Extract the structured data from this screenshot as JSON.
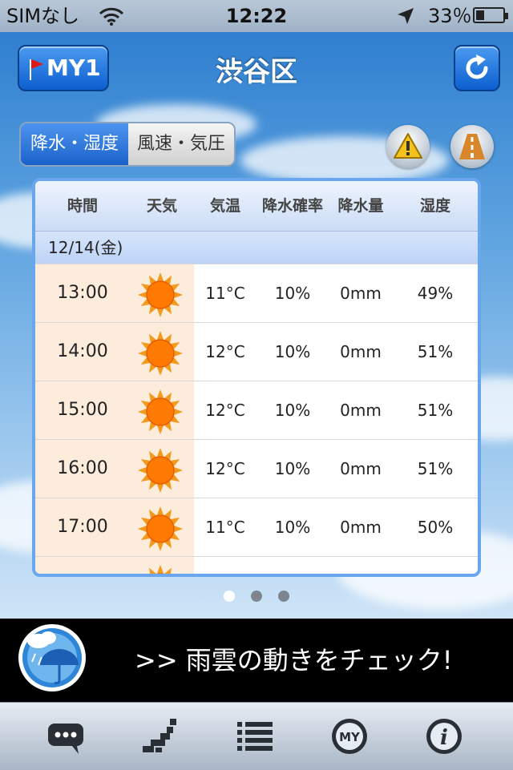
{
  "status": {
    "carrier": "SIMなし",
    "time": "12:22",
    "battery": "33％"
  },
  "header": {
    "my_button": "MY1",
    "title": "渋谷区"
  },
  "segment": {
    "active": "降水・湿度",
    "inactive": "風速・気圧"
  },
  "icons": {
    "warning": "warning-icon",
    "road": "road-icon",
    "refresh": "refresh-icon"
  },
  "table": {
    "headers": [
      "時間",
      "天気",
      "気温",
      "降水確率",
      "降水量",
      "湿度"
    ],
    "date": "12/14(金)",
    "rows": [
      {
        "time": "13:00",
        "weather": "sunny",
        "temp": "11°C",
        "pop": "10%",
        "amount": "0mm",
        "humidity": "49%"
      },
      {
        "time": "14:00",
        "weather": "sunny",
        "temp": "12°C",
        "pop": "10%",
        "amount": "0mm",
        "humidity": "51%"
      },
      {
        "time": "15:00",
        "weather": "sunny",
        "temp": "12°C",
        "pop": "10%",
        "amount": "0mm",
        "humidity": "51%"
      },
      {
        "time": "16:00",
        "weather": "sunny",
        "temp": "12°C",
        "pop": "10%",
        "amount": "0mm",
        "humidity": "51%"
      },
      {
        "time": "17:00",
        "weather": "sunny",
        "temp": "11°C",
        "pop": "10%",
        "amount": "0mm",
        "humidity": "50%"
      }
    ]
  },
  "pager": {
    "pages": 3,
    "current": 1
  },
  "banner": {
    "text": ">> 雨雲の動きをチェック!"
  },
  "tabbar": {
    "items": [
      "chat-icon",
      "japan-map-icon",
      "list-icon",
      "my-icon",
      "info-icon"
    ],
    "my_label": "MY",
    "info_label": "i"
  },
  "colors": {
    "accent": "#1a62cc",
    "sun": "#ff7a00",
    "time_cell": "#fdebdc"
  }
}
